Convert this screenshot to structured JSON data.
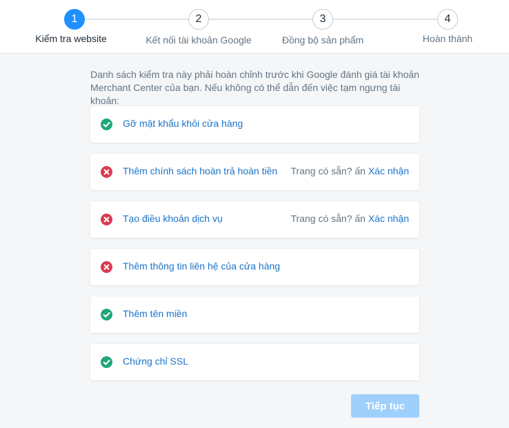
{
  "stepper": {
    "steps": [
      {
        "number": "1",
        "label": "Kiểm tra website",
        "state": "active"
      },
      {
        "number": "2",
        "label": "Kết nối tài khoản Google",
        "state": "pending"
      },
      {
        "number": "3",
        "label": "Đồng bộ sản phẩm",
        "state": "pending"
      },
      {
        "number": "4",
        "label": "Hoàn thành",
        "state": "pending"
      }
    ]
  },
  "intro_text": "Danh sách kiểm tra này phải hoàn chỉnh trước khi Google đánh giá tài khoản Merchant Center của bạn. Nếu không có thể dẫn đến việc tạm ngưng tài khoản:",
  "checklist": [
    {
      "label": "Gỡ mật khẩu khỏi cửa hàng",
      "status": "ok",
      "icon": "check-circle-icon",
      "hint": "",
      "hint_link": ""
    },
    {
      "label": "Thêm chính sách hoàn trả hoàn tiền",
      "status": "error",
      "icon": "error-circle-icon",
      "hint": "Trang có sẵn? ấn ",
      "hint_link": "Xác nhận"
    },
    {
      "label": "Tạo điều khoản dịch vụ",
      "status": "error",
      "icon": "error-circle-icon",
      "hint": "Trang có sẵn? ấn ",
      "hint_link": "Xác nhận"
    },
    {
      "label": "Thêm thông tin liên hệ của cửa hàng",
      "status": "error",
      "icon": "error-circle-icon",
      "hint": "",
      "hint_link": ""
    },
    {
      "label": "Thêm tên miền",
      "status": "ok",
      "icon": "check-circle-icon",
      "hint": "",
      "hint_link": ""
    },
    {
      "label": "Chứng chỉ SSL",
      "status": "ok",
      "icon": "check-circle-icon",
      "hint": "",
      "hint_link": ""
    }
  ],
  "continue_label": "Tiếp tục",
  "colors": {
    "accent": "#1e90ff",
    "link": "#1a73c8",
    "ok": "#1fa67a",
    "error": "#d93a4f",
    "button_disabled": "#9fd0fb"
  }
}
